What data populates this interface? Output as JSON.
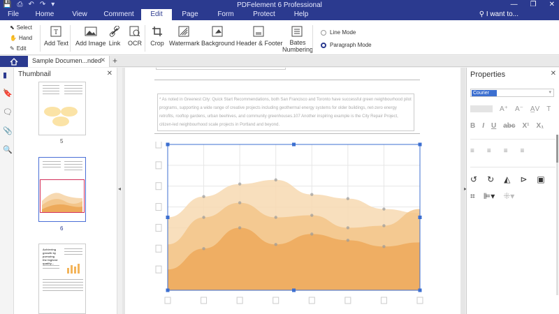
{
  "app": {
    "title": "PDFelement 6 Professional",
    "title_icons": [
      "save-icon",
      "print-icon",
      "undo-icon",
      "redo-icon",
      "dropdown-icon"
    ],
    "window_controls": [
      "minimize-icon",
      "restore-icon",
      "close-icon"
    ]
  },
  "menu": {
    "items": [
      "File",
      "Home",
      "View",
      "Comment",
      "Edit",
      "Page",
      "Form",
      "Protect",
      "Help"
    ],
    "active": "Edit",
    "search": "I want to..."
  },
  "ribbon": {
    "select": "Select",
    "hand": "Hand",
    "edit": "Edit",
    "tools": {
      "add_text": "Add Text",
      "add_image": "Add Image",
      "link": "Link",
      "ocr": "OCR",
      "crop": "Crop",
      "watermark": "Watermark",
      "background": "Background",
      "header_footer": "Header & Footer",
      "bates_1": "Bates",
      "bates_2": "Numbering"
    },
    "line_mode": "Line Mode",
    "paragraph_mode": "Paragraph Mode",
    "selected_mode": "Paragraph Mode"
  },
  "tabs": {
    "home_icon": "home-icon",
    "document": "Sample Documen...nded",
    "close": "✕",
    "add": "+"
  },
  "thumbnails": {
    "title": "Thumbnail",
    "close": "✕",
    "pages": [
      "5",
      "6"
    ],
    "selected_page": "6",
    "page7_heading": "Achieving growth by pursuing the highest quality..."
  },
  "document": {
    "paragraph": "* As noted in Greenest City: Quick Start Recommendations, both San Francisco and Toronto have successful green neighbourhood pilot programs, supporting a wide range of creative projects including geothermal energy systems for older buildings, net-zero energy retrofits, rooftop gardens, urban beehives, and community greenhouses.107 Another inspiring example is the City Repair Project, citizen-led neighbourhood scale projects in Portland and beyond."
  },
  "properties": {
    "title": "Properties",
    "close": "✕",
    "font": "Courier"
  },
  "colors": {
    "brand": "#2b3a8f",
    "selection": "#3c6fd0",
    "area_light": "#f7d9b1",
    "area_mid": "#f3c58a",
    "area_dark": "#eda95a"
  },
  "chart_data": {
    "type": "area",
    "x": [
      0,
      1,
      2,
      3,
      4,
      5,
      6,
      7
    ],
    "series": [
      {
        "values": [
          3.5,
          4.5,
          5.1,
          5.3,
          4.6,
          4.4,
          3.9,
          3.7
        ]
      },
      {
        "values": [
          2.2,
          3.5,
          4.2,
          3.5,
          3.6,
          3.0,
          3.1,
          3.9
        ]
      },
      {
        "values": [
          1.0,
          2.0,
          3.0,
          2.2,
          2.7,
          2.4,
          2.1,
          2.3
        ]
      }
    ],
    "ylim": [
      0,
      7
    ],
    "grid": true
  }
}
